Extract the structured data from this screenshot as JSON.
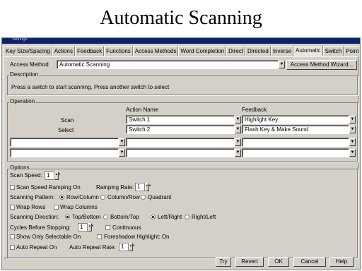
{
  "slide_title": "Automatic Scanning",
  "window_title": "Settings",
  "tabs": [
    "Key Size/Spacing",
    "Actions",
    "Feedback",
    "Functions",
    "Access Methods",
    "Word Completion",
    "Direct",
    "Directed",
    "Inverse",
    "Automatic",
    "Switch",
    "Point"
  ],
  "access_method": {
    "label": "Access Method",
    "value": "Automatic Scanning",
    "wizard_button": "Access Method Wizard..."
  },
  "description": {
    "title": "Description",
    "text": "Press a switch to start scanning. Press another switch to select"
  },
  "operation": {
    "title": "Operation",
    "col_action": "Action Name",
    "col_feedback": "Feedback",
    "rows": [
      {
        "label": "Scan",
        "action": "Switch 1",
        "feedback": "Highlight Key"
      },
      {
        "label": "Select",
        "action": "Switch 2",
        "feedback": "Flash Key & Make Sound"
      }
    ]
  },
  "options": {
    "title": "Options",
    "scan_speed_label": "Scan Speed:",
    "scan_speed_value": "1",
    "scan_speed_ramping": "Scan Speed Ramping On",
    "ramping_rate_label": "Ramping Rate:",
    "ramping_rate_value": "1",
    "scanning_pattern_label": "Scanning Pattern:",
    "pattern_row_column": "Row/Column",
    "pattern_column_row": "Column/Row",
    "pattern_quadrant": "Quadrant",
    "wrap_rows": "Wrap Rows",
    "wrap_columns": "Wrap Columns",
    "scanning_direction_label": "Scanning Direction:",
    "dir_top_bottom": "Top/Bottom",
    "dir_bottom_top": "Bottom/Top",
    "dir_left_right": "Left/Right",
    "dir_right_left": "Right/Left",
    "cycles_label": "Cycles Before Stopping:",
    "cycles_value": "1",
    "continuous": "Continuous",
    "show_only_selectable": "Show Only Selectable On",
    "foreshadow": "Foreshadow Highlight: On",
    "auto_repeat": "Auto Repeat On",
    "auto_repeat_rate_label": "Auto Repeat Rate:",
    "auto_repeat_rate_value": "1"
  },
  "buttons": {
    "try": "Try",
    "revert": "Revert",
    "ok": "OK",
    "cancel": "Cancel",
    "help": "Help"
  }
}
